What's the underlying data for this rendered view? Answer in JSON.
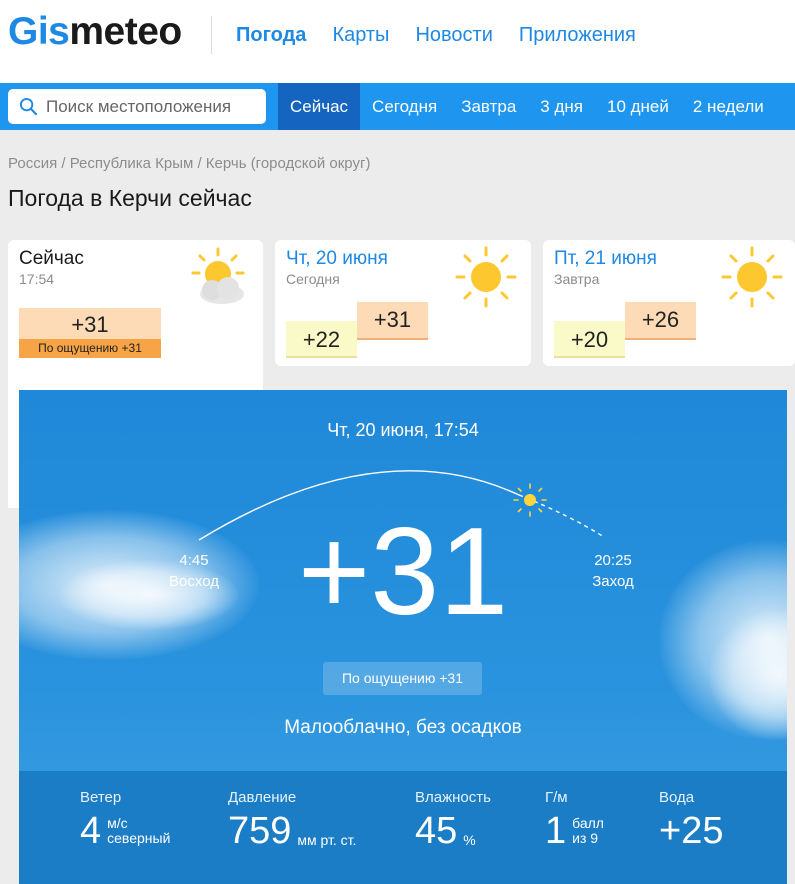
{
  "header": {
    "logo_gis": "Gis",
    "logo_meteo": "meteo",
    "nav": [
      "Погода",
      "Карты",
      "Новости",
      "Приложения"
    ]
  },
  "search": {
    "placeholder": "Поиск местоположения"
  },
  "tabs": [
    "Сейчас",
    "Сегодня",
    "Завтра",
    "3 дня",
    "10 дней",
    "2 недели"
  ],
  "breadcrumb": "Россия / Республика Крым / Керчь (городской округ)",
  "page_title": "Погода в Керчи сейчас",
  "now_card": {
    "title": "Сейчас",
    "time": "17:54",
    "temp": "+31",
    "feels": "По ощущению +31",
    "icon": "sun-cloud-icon"
  },
  "today_card": {
    "title": "Чт, 20 июня",
    "sub": "Сегодня",
    "low": "+22",
    "high": "+31",
    "icon": "sun-icon"
  },
  "tomorrow_card": {
    "title": "Пт, 21 июня",
    "sub": "Завтра",
    "low": "+20",
    "high": "+26",
    "icon": "sun-icon"
  },
  "hero": {
    "datetime": "Чт, 20 июня, 17:54",
    "sunrise_time": "4:45",
    "sunrise_label": "Восход",
    "sunset_time": "20:25",
    "sunset_label": "Заход",
    "temp": "+31",
    "feels": "По ощущению +31",
    "condition": "Малооблачно, без осадков"
  },
  "stats": {
    "wind": {
      "label": "Ветер",
      "value": "4",
      "unit": "м/с",
      "dir": "северный"
    },
    "pressure": {
      "label": "Давление",
      "value": "759",
      "unit": "мм рт. ст."
    },
    "humidity": {
      "label": "Влажность",
      "value": "45",
      "unit": "%"
    },
    "geomagnetic": {
      "label": "Г/м",
      "value": "1",
      "unit1": "балл",
      "unit2": "из 9"
    },
    "water": {
      "label": "Вода",
      "value": "+25"
    }
  },
  "colors": {
    "brand_blue": "#1e88e5",
    "nav_blue": "#1e96f0",
    "active_tab": "#1565c0",
    "warm_temp": "#fcdbb6",
    "mild_temp": "#fafac8",
    "feels_badge": "#f6a446",
    "sun": "#fdc82f"
  }
}
